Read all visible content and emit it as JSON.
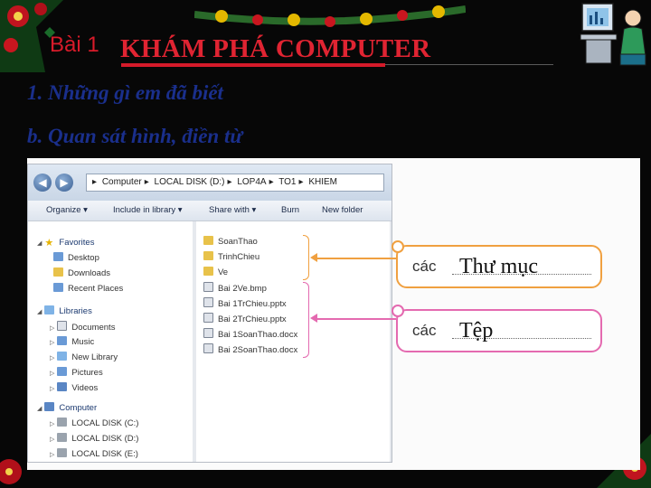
{
  "header": {
    "lesson": "Bài 1",
    "title": "KHÁM PHÁ COMPUTER"
  },
  "content": {
    "line1": "1. Những gì em đã biết",
    "line2": "b. Quan sát hình, điền từ"
  },
  "explorer": {
    "breadcrumb": [
      "Computer",
      "LOCAL DISK (D:)",
      "LOP4A",
      "TO1",
      "KHIEM"
    ],
    "toolbar": {
      "organize": "Organize ▾",
      "include": "Include in library ▾",
      "share": "Share with ▾",
      "burn": "Burn",
      "new_folder": "New folder"
    },
    "favorites": {
      "label": "Favorites",
      "items": [
        "Desktop",
        "Downloads",
        "Recent Places"
      ]
    },
    "libraries": {
      "label": "Libraries",
      "items": [
        "Documents",
        "Music",
        "New Library",
        "Pictures",
        "Videos"
      ]
    },
    "computer": {
      "label": "Computer",
      "items": [
        "LOCAL DISK (C:)",
        "LOCAL DISK (D:)",
        "LOCAL DISK (E:)"
      ]
    },
    "folders": [
      "SoanThao",
      "TrinhChieu",
      "Ve"
    ],
    "files": [
      "Bai 2Ve.bmp",
      "Bai 1TrChieu.pptx",
      "Bai 2TrChieu.pptx",
      "Bai 1SoanThao.docx",
      "Bai 2SoanThao.docx"
    ]
  },
  "boxes": [
    {
      "prefix": "các",
      "answer": "Thư mục"
    },
    {
      "prefix": "các",
      "answer": "Tệp"
    }
  ],
  "colors": {
    "title_red": "#e02432",
    "text_blue": "#1a2f8c",
    "folder_box": "#f0a040",
    "file_box": "#e46ab0"
  }
}
